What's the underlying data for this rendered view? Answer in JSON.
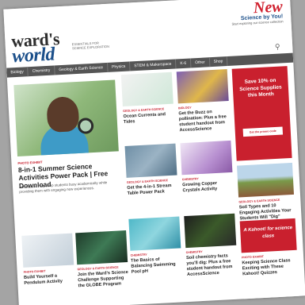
{
  "header": {
    "logo_line1": "ward's",
    "logo_line2": "world",
    "tagline": "Essentials for Science Exploration",
    "promo_new": "New",
    "promo_sub": "Science by You!",
    "promo_small": "Start exploring our science collection"
  },
  "nav": {
    "items": [
      "Biology",
      "Chemistry",
      "Geology & Earth Science",
      "Physics",
      "STEM & Makerspace",
      "K-6",
      "Other",
      "Shop"
    ]
  },
  "hero": {
    "tag": "Photo Exhibit",
    "title": "8-in-1 Summer Science Activities Power Pack | Free Download",
    "desc": "Activities to help keep students busy academically while providing them with engaging new experiences."
  },
  "cards": [
    {
      "tag": "Geology & Earth Science",
      "title": "Ocean Currents and Tides"
    },
    {
      "tag": "Biology",
      "title": "Get the Buzz on pollination: Plus a free student handout from AccessScience"
    },
    {
      "tag": "Geology & Earth Science",
      "title": "Get the 4-in-1 Stream Table Power Pack"
    },
    {
      "tag": "Chemistry",
      "title": "Growing Copper Crystals Activity"
    },
    {
      "tag": "Geology & Earth Science",
      "title": "Soil Types and 10 Engaging Activities Your Students Will \"Dig\""
    },
    {
      "tag": "Photo Exhibit",
      "title": "Build Yourself a Pendulum Activity"
    },
    {
      "tag": "Geology & Earth Science",
      "title": "Join the Ward's Science Challenge Supporting the GLOBE Program"
    },
    {
      "tag": "Chemistry",
      "title": "The Basics of Balancing Swimming Pool pH"
    },
    {
      "tag": "Chemistry",
      "title": "Soil chemistry facts you'll dig: Plus a free student handout from AccessScience"
    },
    {
      "tag": "Photo Exhibit",
      "title": "Keeping Science Class Exciting with These Kahoot! Quizzes"
    }
  ],
  "promo_box": {
    "text": "Save 10% on Science Supplies this Month",
    "button": "Get the promo code"
  },
  "kahoot_banner": "A Kahoot! for science class",
  "colors": {
    "accent_red": "#c9202e",
    "brand_blue": "#1b4f8a",
    "nav_gray": "#555555"
  }
}
